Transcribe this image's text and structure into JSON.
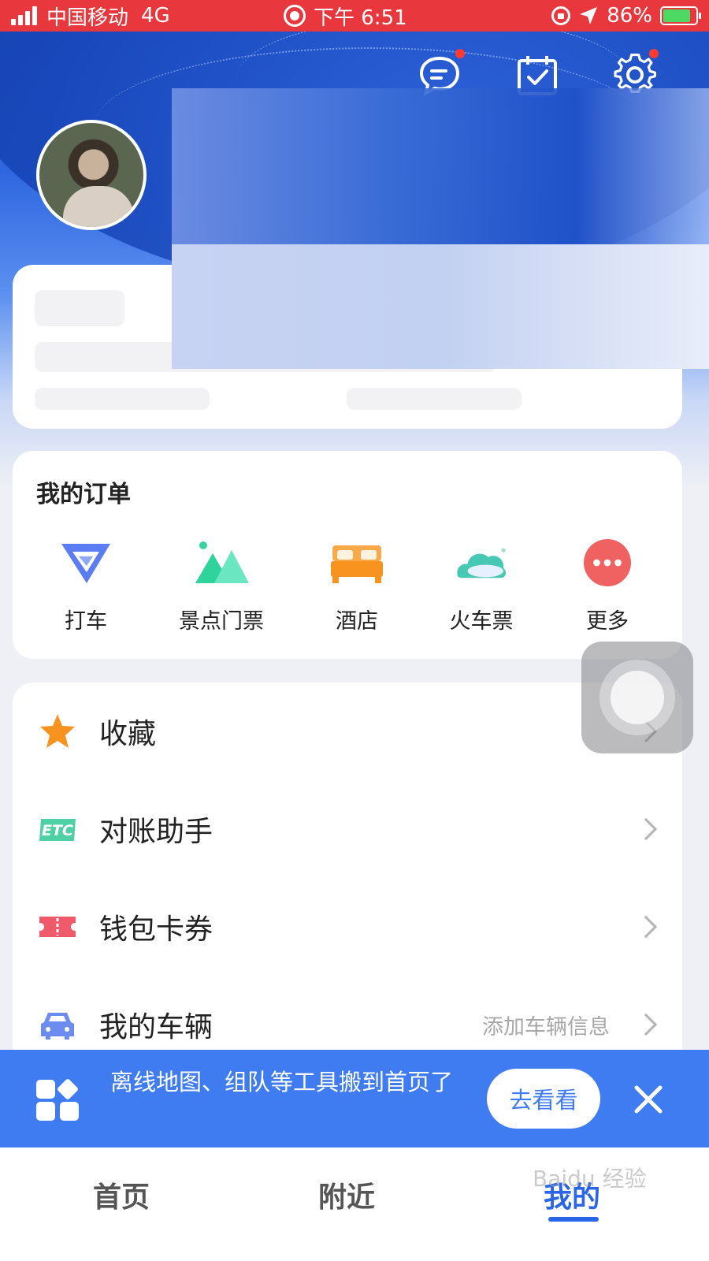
{
  "status_bar": {
    "carrier": "中国移动",
    "network": "4G",
    "time": "下午 6:51",
    "battery": "86%",
    "battery_level": 0.86
  },
  "header_icons": [
    "message-icon",
    "checkin-calendar-icon",
    "settings-icon"
  ],
  "orders": {
    "title": "我的订单",
    "items": [
      {
        "label": "打车",
        "icon": "taxi-icon"
      },
      {
        "label": "景点门票",
        "icon": "mountain-ticket-icon"
      },
      {
        "label": "酒店",
        "icon": "bed-icon"
      },
      {
        "label": "火车票",
        "icon": "train-icon"
      },
      {
        "label": "更多",
        "icon": "more-icon"
      }
    ]
  },
  "menu": [
    {
      "label": "收藏",
      "icon": "star-icon",
      "hint": ""
    },
    {
      "label": "对账助手",
      "icon": "etc-icon",
      "hint": ""
    },
    {
      "label": "钱包卡券",
      "icon": "ticket-icon",
      "hint": ""
    },
    {
      "label": "我的车辆",
      "icon": "car-icon",
      "hint": "添加车辆信息"
    }
  ],
  "banner": {
    "text": "离线地图、组队等工具搬到首页了",
    "button": "去看看"
  },
  "tabs": [
    {
      "label": "首页",
      "active": false
    },
    {
      "label": "附近",
      "active": false
    },
    {
      "label": "我的",
      "active": true
    }
  ],
  "watermark": "Baidu 经验",
  "colors": {
    "status_bar": "#e8383d",
    "accent": "#2a64e8",
    "banner": "#3f7cf2",
    "star": "#f7931e",
    "etc": "#4fd1a5",
    "ticket": "#ef5b6a",
    "car": "#6c8cf0"
  }
}
